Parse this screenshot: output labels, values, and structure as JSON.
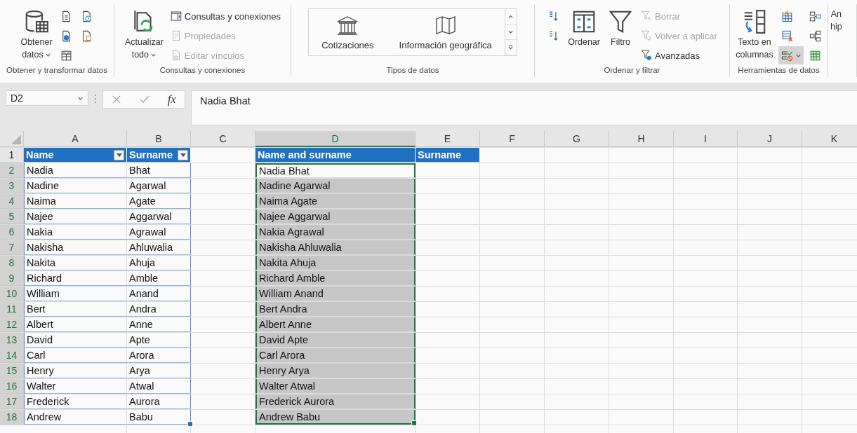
{
  "ribbon": {
    "groups": [
      {
        "label": "Obtener y transformar datos",
        "controls": [
          {
            "kind": "large",
            "lines": [
              "Obtener",
              "datos"
            ],
            "caret": true
          },
          {
            "kind": "icon",
            "highlighted": false
          },
          {
            "kind": "icon",
            "highlighted": false
          },
          {
            "kind": "icon",
            "highlighted": false
          },
          {
            "kind": "icon",
            "highlighted": false
          },
          {
            "kind": "icon",
            "highlighted": false
          }
        ]
      },
      {
        "label": "Consultas y conexiones",
        "controls": [
          {
            "kind": "large",
            "lines": [
              "Actualizar",
              "todo"
            ],
            "caret": true
          },
          {
            "kind": "small",
            "label": "Consultas y conexiones",
            "disabled": false
          },
          {
            "kind": "small",
            "label": "Propiedades",
            "disabled": true
          },
          {
            "kind": "small",
            "label": "Editar vínculos",
            "disabled": true
          }
        ]
      },
      {
        "label": "Tipos de datos",
        "controls": [
          {
            "kind": "gallery",
            "items": [
              "Cotizaciones",
              "Información geográfica"
            ]
          }
        ]
      },
      {
        "label": "Ordenar y filtrar",
        "controls": [
          {
            "kind": "icon",
            "highlighted": false
          },
          {
            "kind": "icon",
            "highlighted": false
          },
          {
            "kind": "large",
            "lines": [
              "Ordenar"
            ]
          },
          {
            "kind": "large",
            "lines": [
              "Filtro"
            ]
          },
          {
            "kind": "small",
            "label": "Borrar",
            "disabled": true
          },
          {
            "kind": "small",
            "label": "Volver a aplicar",
            "disabled": true
          },
          {
            "kind": "small",
            "label": "Avanzadas",
            "disabled": false
          }
        ]
      },
      {
        "label": "Herramientas de datos",
        "controls": [
          {
            "kind": "large",
            "lines": [
              "Texto en",
              "columnas"
            ]
          },
          {
            "kind": "icon",
            "highlighted": false
          },
          {
            "kind": "icon",
            "highlighted": false
          },
          {
            "kind": "icon",
            "highlighted": true,
            "caret": true
          },
          {
            "kind": "icon",
            "highlighted": false
          },
          {
            "kind": "icon",
            "highlighted": false
          },
          {
            "kind": "icon",
            "highlighted": false
          }
        ]
      },
      {
        "controls": [
          {
            "kind": "large",
            "lines": [
              "An",
              "hip"
            ]
          }
        ]
      }
    ]
  },
  "formula_bar": {
    "name_box": "D2",
    "function_label": "fx",
    "formula": "Nadia Bhat"
  },
  "sheet": {
    "columns": [
      {
        "label": "A",
        "selected": false
      },
      {
        "label": "B",
        "selected": false
      },
      {
        "label": "C",
        "selected": false
      },
      {
        "label": "D",
        "selected": true
      },
      {
        "label": "E",
        "selected": false
      },
      {
        "label": "F",
        "selected": false
      },
      {
        "label": "G",
        "selected": false
      },
      {
        "label": "H",
        "selected": false
      },
      {
        "label": "I",
        "selected": false
      },
      {
        "label": "J",
        "selected": false
      },
      {
        "label": "K",
        "selected": false
      }
    ],
    "header": {
      "number": "1",
      "name": "Name",
      "surname": "Surname",
      "combined": "Name and surname",
      "extra": "Surname",
      "filter_buttons": true
    },
    "rows": [
      {
        "number": "2",
        "name": "Nadia",
        "surname": "Bhat",
        "combined": "Nadia Bhat",
        "selected": true,
        "active": true
      },
      {
        "number": "3",
        "name": "Nadine",
        "surname": "Agarwal",
        "combined": "Nadine Agarwal",
        "selected": true,
        "active": false
      },
      {
        "number": "4",
        "name": "Naima",
        "surname": "Agate",
        "combined": "Naima Agate",
        "selected": true,
        "active": false
      },
      {
        "number": "5",
        "name": "Najee",
        "surname": "Aggarwal",
        "combined": "Najee Aggarwal",
        "selected": true,
        "active": false
      },
      {
        "number": "6",
        "name": "Nakia",
        "surname": "Agrawal",
        "combined": "Nakia Agrawal",
        "selected": true,
        "active": false
      },
      {
        "number": "7",
        "name": "Nakisha",
        "surname": "Ahluwalia",
        "combined": "Nakisha Ahluwalia",
        "selected": true,
        "active": false
      },
      {
        "number": "8",
        "name": "Nakita",
        "surname": "Ahuja",
        "combined": "Nakita Ahuja",
        "selected": true,
        "active": false
      },
      {
        "number": "9",
        "name": "Richard",
        "surname": "Amble",
        "combined": "Richard Amble",
        "selected": true,
        "active": false
      },
      {
        "number": "10",
        "name": "William",
        "surname": "Anand",
        "combined": "William Anand",
        "selected": true,
        "active": false
      },
      {
        "number": "11",
        "name": "Bert",
        "surname": "Andra",
        "combined": "Bert Andra",
        "selected": true,
        "active": false
      },
      {
        "number": "12",
        "name": "Albert",
        "surname": "Anne",
        "combined": "Albert Anne",
        "selected": true,
        "active": false
      },
      {
        "number": "13",
        "name": "David",
        "surname": "Apte",
        "combined": "David Apte",
        "selected": true,
        "active": false
      },
      {
        "number": "14",
        "name": "Carl",
        "surname": "Arora",
        "combined": "Carl Arora",
        "selected": true,
        "active": false
      },
      {
        "number": "15",
        "name": "Henry",
        "surname": "Arya",
        "combined": "Henry Arya",
        "selected": true,
        "active": false
      },
      {
        "number": "16",
        "name": "Walter",
        "surname": "Atwal",
        "combined": "Walter Atwal",
        "selected": true,
        "active": false
      },
      {
        "number": "17",
        "name": "Frederick",
        "surname": "Aurora",
        "combined": "Frederick Aurora",
        "selected": true,
        "active": false
      },
      {
        "number": "18",
        "name": "Andrew",
        "surname": "Babu",
        "combined": "Andrew Babu",
        "selected": true,
        "active": false
      }
    ]
  }
}
